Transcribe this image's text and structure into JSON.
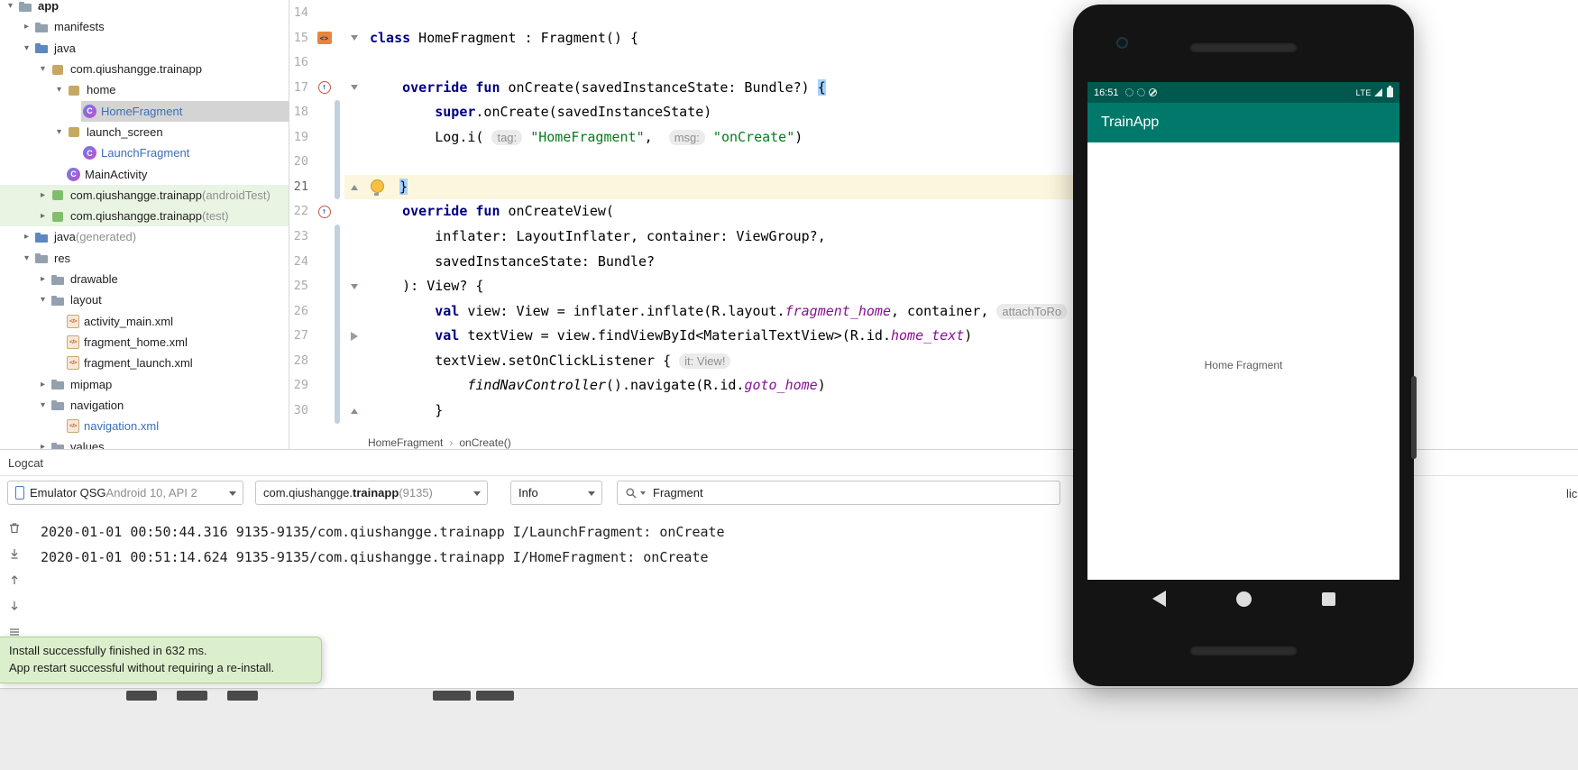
{
  "project_tree": {
    "rows": [
      {
        "label": "app",
        "indent": 0,
        "chevron": "open",
        "icon": "folder-app",
        "bold": true
      },
      {
        "label": "manifests",
        "indent": 1,
        "chevron": "closed",
        "icon": "folder"
      },
      {
        "label": "java",
        "indent": 1,
        "chevron": "open",
        "icon": "folder-src"
      },
      {
        "label": "com.qiushangge.trainapp",
        "indent": 2,
        "chevron": "open",
        "icon": "package"
      },
      {
        "label": "home",
        "indent": 3,
        "chevron": "open",
        "icon": "package"
      },
      {
        "label": "HomeFragment",
        "indent": 4,
        "icon": "kotlin",
        "color": "blue",
        "selected": true
      },
      {
        "label": "launch_screen",
        "indent": 3,
        "chevron": "open",
        "icon": "package"
      },
      {
        "label": "LaunchFragment",
        "indent": 4,
        "icon": "kotlin",
        "color": "blue"
      },
      {
        "label": "MainActivity",
        "indent": 3,
        "icon": "kotlin"
      },
      {
        "label": "com.qiushangge.trainapp",
        "suffix": " (androidTest)",
        "indent": 2,
        "chevron": "closed",
        "icon": "package-green",
        "bg": "green"
      },
      {
        "label": "com.qiushangge.trainapp",
        "suffix": " (test)",
        "indent": 2,
        "chevron": "closed",
        "icon": "package-green",
        "bg": "green"
      },
      {
        "label": "java",
        "suffix": " (generated)",
        "indent": 1,
        "chevron": "closed",
        "icon": "folder-gen"
      },
      {
        "label": "res",
        "indent": 1,
        "chevron": "open",
        "icon": "folder-res"
      },
      {
        "label": "drawable",
        "indent": 2,
        "chevron": "closed",
        "icon": "folder"
      },
      {
        "label": "layout",
        "indent": 2,
        "chevron": "open",
        "icon": "folder"
      },
      {
        "label": "activity_main.xml",
        "indent": 3,
        "icon": "xml"
      },
      {
        "label": "fragment_home.xml",
        "indent": 3,
        "icon": "xml"
      },
      {
        "label": "fragment_launch.xml",
        "indent": 3,
        "icon": "xml"
      },
      {
        "label": "mipmap",
        "indent": 2,
        "chevron": "closed",
        "icon": "folder"
      },
      {
        "label": "navigation",
        "indent": 2,
        "chevron": "open",
        "icon": "folder"
      },
      {
        "label": "navigation.xml",
        "indent": 3,
        "icon": "xml",
        "color": "blue"
      },
      {
        "label": "values",
        "indent": 2,
        "chevron": "closed",
        "icon": "folder"
      }
    ]
  },
  "editor": {
    "current_line": 21,
    "breadcrumb": {
      "class": "HomeFragment",
      "method": "onCreate()"
    },
    "lines": [
      {
        "n": 14,
        "tokens": []
      },
      {
        "n": 15,
        "gutter_icon": "kotlin-mark",
        "fold": "down",
        "tokens": [
          {
            "c": "kw",
            "t": "class"
          },
          {
            "c": "p",
            "t": " HomeFragment : Fragment() {"
          }
        ]
      },
      {
        "n": 16,
        "tokens": []
      },
      {
        "n": 17,
        "gutter_icon": "override",
        "fold": "down",
        "tokens": [
          {
            "c": "p",
            "t": "    "
          },
          {
            "c": "kw",
            "t": "override fun"
          },
          {
            "c": "p",
            "t": " onCreate(savedInstanceState: Bundle?) "
          },
          {
            "c": "sel",
            "t": "{"
          }
        ]
      },
      {
        "n": 18,
        "tokens": [
          {
            "c": "p",
            "t": "        "
          },
          {
            "c": "kw",
            "t": "super"
          },
          {
            "c": "p",
            "t": ".onCreate(savedInstanceState)"
          }
        ]
      },
      {
        "n": 19,
        "tokens": [
          {
            "c": "p",
            "t": "        Log.i( "
          },
          {
            "c": "hint",
            "t": "tag:"
          },
          {
            "c": "p",
            "t": " "
          },
          {
            "c": "str",
            "t": "\"HomeFragment\""
          },
          {
            "c": "p",
            "t": ",  "
          },
          {
            "c": "hint",
            "t": "msg:"
          },
          {
            "c": "p",
            "t": " "
          },
          {
            "c": "str",
            "t": "\"onCreate\""
          },
          {
            "c": "p",
            "t": ")"
          }
        ]
      },
      {
        "n": 20,
        "tokens": []
      },
      {
        "n": 21,
        "fold": "up",
        "tokens": [
          {
            "c": "bulb",
            "t": ""
          },
          {
            "c": "p",
            "t": " "
          },
          {
            "c": "sel",
            "t": "}"
          }
        ]
      },
      {
        "n": 22,
        "gutter_icon": "override",
        "tokens": [
          {
            "c": "p",
            "t": "    "
          },
          {
            "c": "kw",
            "t": "override fun"
          },
          {
            "c": "p",
            "t": " onCreateView("
          }
        ]
      },
      {
        "n": 23,
        "tokens": [
          {
            "c": "p",
            "t": "        inflater: LayoutInflater, container: ViewGroup?,"
          }
        ]
      },
      {
        "n": 24,
        "tokens": [
          {
            "c": "p",
            "t": "        savedInstanceState: Bundle?"
          }
        ]
      },
      {
        "n": 25,
        "fold": "down",
        "tokens": [
          {
            "c": "p",
            "t": "    ): View? {"
          }
        ]
      },
      {
        "n": 26,
        "tokens": [
          {
            "c": "p",
            "t": "        "
          },
          {
            "c": "kw",
            "t": "val"
          },
          {
            "c": "p",
            "t": " view: View = inflater.inflate(R.layout."
          },
          {
            "c": "fld",
            "t": "fragment_home"
          },
          {
            "c": "p",
            "t": ", container, "
          },
          {
            "c": "hint",
            "t": "attachToRo"
          }
        ]
      },
      {
        "n": 27,
        "fold": "play",
        "tokens": [
          {
            "c": "p",
            "t": "        "
          },
          {
            "c": "kw",
            "t": "val"
          },
          {
            "c": "p",
            "t": " textView = view.findViewById<MaterialTextView>(R.id."
          },
          {
            "c": "fld",
            "t": "home_text"
          },
          {
            "c": "p",
            "t": ")"
          }
        ]
      },
      {
        "n": 28,
        "tokens": [
          {
            "c": "p",
            "t": "        textView.setOnClickListener { "
          },
          {
            "c": "hint",
            "t": "it: View!"
          }
        ]
      },
      {
        "n": 29,
        "tokens": [
          {
            "c": "p",
            "t": "            "
          },
          {
            "c": "fni",
            "t": "findNavController"
          },
          {
            "c": "p",
            "t": "().navigate(R.id."
          },
          {
            "c": "fld",
            "t": "goto_home"
          },
          {
            "c": "p",
            "t": ")"
          }
        ]
      },
      {
        "n": 30,
        "fold": "up",
        "tokens": [
          {
            "c": "p",
            "t": "        }"
          }
        ]
      }
    ]
  },
  "logcat": {
    "panel_title": "Logcat",
    "device": {
      "name": "Emulator QSG ",
      "details": "Android 10, API 2"
    },
    "process": {
      "prefix": "com.qiushangge.",
      "bold": "trainapp",
      "suffix": " (9135)"
    },
    "level": "Info",
    "search": "Fragment",
    "clipped_label": "lic",
    "tool_icons": [
      "clear-logcat",
      "scroll-to-end",
      "move-up",
      "move-down",
      "configure"
    ],
    "entries": [
      "2020-01-01 00:50:44.316 9135-9135/com.qiushangge.trainapp I/LaunchFragment: onCreate",
      "2020-01-01 00:51:14.624 9135-9135/com.qiushangge.trainapp I/HomeFragment: onCreate"
    ]
  },
  "notification": {
    "line1": "Install successfully finished in 632 ms.",
    "line2": "App restart successful without requiring a re-install."
  },
  "emulator": {
    "status": {
      "time": "16:51",
      "carrier": "LTE",
      "icons": [
        "gear",
        "gear",
        "data-saver"
      ]
    },
    "app_title": "TrainApp",
    "body_text": "Home Fragment",
    "nav": [
      "back",
      "home",
      "recents"
    ]
  },
  "colors": {
    "appbar_teal": "#00796B",
    "statusbar_teal": "#00584E",
    "notification_green": "#DCEFCC",
    "brace_match_blue": "#A6D2FF",
    "current_line_yellow": "#FCF6DE",
    "test_source_green": "#E9F4E3"
  }
}
